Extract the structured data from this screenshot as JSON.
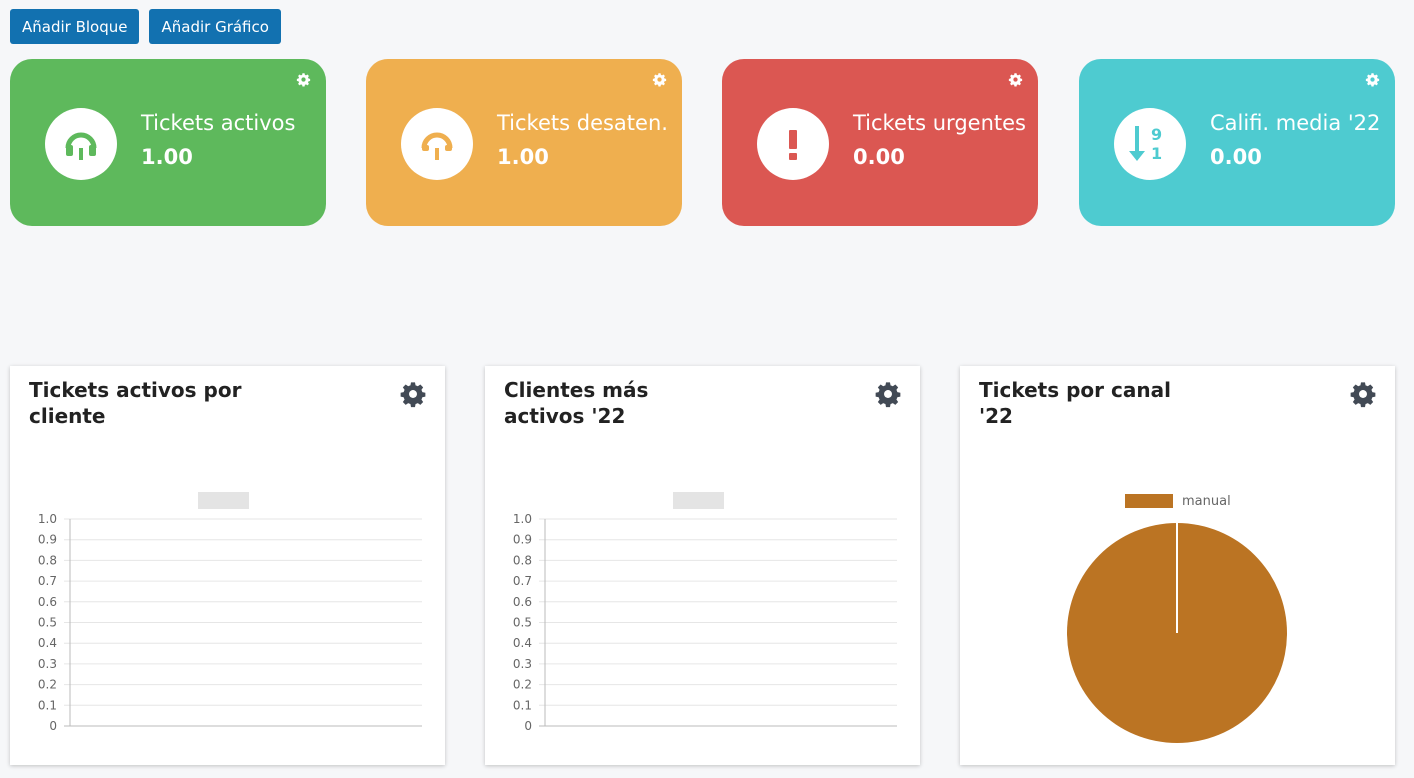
{
  "toolbar": {
    "add_block_label": "Añadir Bloque",
    "add_chart_label": "Añadir Gráfico"
  },
  "stats": [
    {
      "label": "Tickets activos",
      "value": "1.00",
      "color": "#5eb95c",
      "icon": "headset-icon"
    },
    {
      "label": "Tickets desaten.",
      "value": "1.00",
      "color": "#efaf4f",
      "icon": "headset-icon"
    },
    {
      "label": "Tickets urgentes",
      "value": "0.00",
      "color": "#db5752",
      "icon": "exclamation-icon"
    },
    {
      "label": "Califi. media '22",
      "value": "0.00",
      "color": "#4ecbd0",
      "icon": "sort-numeric-icon"
    }
  ],
  "cards": [
    {
      "title": "Tickets activos por cliente"
    },
    {
      "title": "Clientes más activos '22"
    },
    {
      "title": "Tickets por canal '22"
    }
  ],
  "chart_data": [
    {
      "type": "bar",
      "categories": [],
      "values": [],
      "yticks": [
        "1.0",
        "0.9",
        "0.8",
        "0.7",
        "0.6",
        "0.5",
        "0.4",
        "0.3",
        "0.2",
        "0.1",
        "0"
      ],
      "ylim": [
        0,
        1
      ],
      "grid": true,
      "legend": "top-center (empty)"
    },
    {
      "type": "bar",
      "categories": [],
      "values": [],
      "yticks": [
        "1.0",
        "0.9",
        "0.8",
        "0.7",
        "0.6",
        "0.5",
        "0.4",
        "0.3",
        "0.2",
        "0.1",
        "0"
      ],
      "ylim": [
        0,
        1
      ],
      "grid": true,
      "legend": "top-center (empty)"
    },
    {
      "type": "pie",
      "categories": [
        "manual"
      ],
      "values": [
        1
      ],
      "colors": [
        "#bb7423"
      ],
      "legend": "top-center"
    }
  ]
}
